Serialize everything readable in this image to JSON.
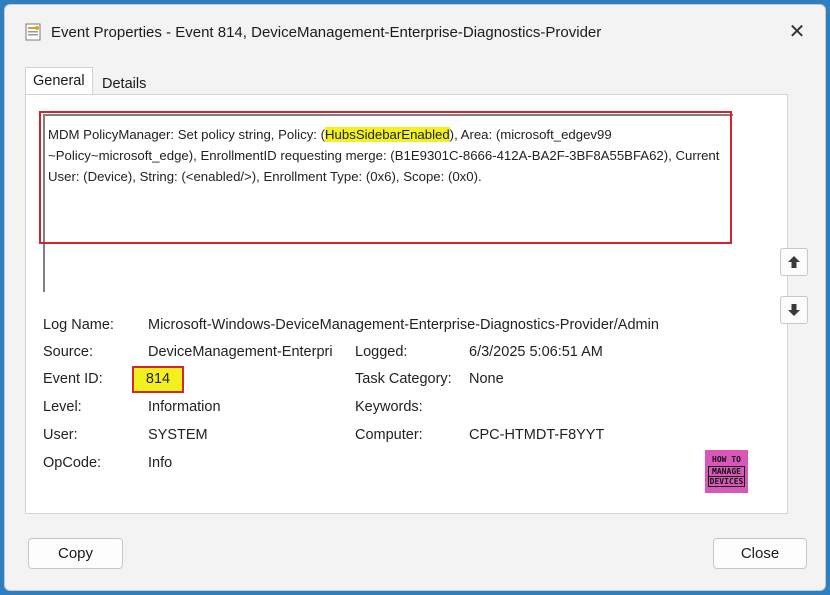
{
  "window": {
    "title": "Event Properties - Event 814, DeviceManagement-Enterprise-Diagnostics-Provider",
    "close_glyph": "✕"
  },
  "tabs": [
    {
      "label": "General",
      "active": true
    },
    {
      "label": "Details",
      "active": false
    }
  ],
  "description": {
    "part1": "MDM PolicyManager: Set policy string, Policy: (",
    "highlight": "HubsSidebarEnabled",
    "part2": "), Area: (microsoft_edgev99 ~Policy~microsoft_edge), EnrollmentID requesting merge: (B1E9301C-8666-412A-BA2F-3BF8A55BFA62), Current User: (Device), String: (<enabled/>), Enrollment Type: (0x6), Scope: (0x0)."
  },
  "fields": {
    "log_name_label": "Log Name:",
    "log_name_value": "Microsoft-Windows-DeviceManagement-Enterprise-Diagnostics-Provider/Admin",
    "source_label": "Source:",
    "source_value": "DeviceManagement-Enterpri",
    "logged_label": "Logged:",
    "logged_value": "6/3/2025 5:06:51 AM",
    "event_id_label": "Event ID:",
    "event_id_value": "814",
    "task_category_label": "Task Category:",
    "task_category_value": "None",
    "level_label": "Level:",
    "level_value": "Information",
    "keywords_label": "Keywords:",
    "keywords_value": "",
    "user_label": "User:",
    "user_value": "SYSTEM",
    "computer_label": "Computer:",
    "computer_value": "CPC-HTMDT-F8YYT",
    "opcode_label": "OpCode:",
    "opcode_value": "Info"
  },
  "logo": {
    "line1": "HOW TO",
    "line2": "MANAGE",
    "line3": "DEVICES",
    "color": "#d857b8"
  },
  "buttons": {
    "copy": "Copy",
    "close": "Close"
  },
  "colors": {
    "highlight_yellow": "#f2f01e",
    "annotation_red": "#d6262d",
    "background_blue": "#2e7fc0"
  }
}
